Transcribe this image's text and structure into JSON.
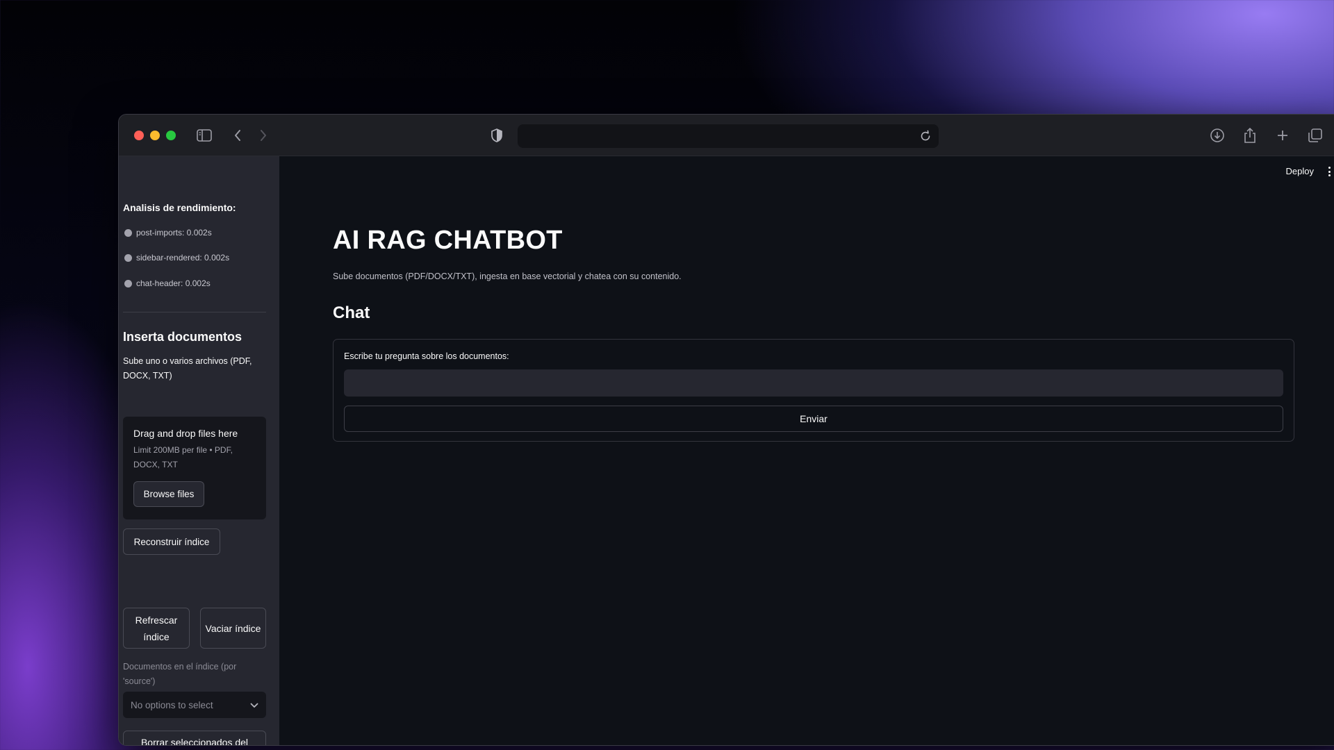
{
  "sidebar": {
    "perf_title": "Analisis de rendimiento:",
    "perf_items": [
      "post-imports: 0.002s",
      "sidebar-rendered: 0.002s",
      "chat-header: 0.002s"
    ],
    "upload_title": "Inserta documentos",
    "upload_subtitle": "Sube uno o varios archivos (PDF, DOCX, TXT)",
    "dropzone_title": "Drag and drop files here",
    "dropzone_limit": "Limit 200MB per file • PDF, DOCX, TXT",
    "browse_label": "Browse files",
    "rebuild_label": "Reconstruir índice",
    "refresh_label": "Refrescar índice",
    "empty_label": "Vaciar índice",
    "docs_label": "Documentos en el índice (por 'source')",
    "select_placeholder": "No options to select",
    "delete_label": "Borrar seleccionados del"
  },
  "header": {
    "deploy_label": "Deploy"
  },
  "main": {
    "title": "AI RAG CHATBOT",
    "subtitle": "Sube documentos (PDF/DOCX/TXT), ingesta en base vectorial y chatea con su contenido.",
    "chat_title": "Chat",
    "question_label": "Escribe tu pregunta sobre los documentos:",
    "question_value": "",
    "send_label": "Enviar"
  },
  "colors": {
    "app_bg": "#0e1117",
    "sidebar_bg": "#262730",
    "titlebar_bg": "#1e1f24"
  },
  "icons": [
    "sidebar-toggle-icon",
    "back-icon",
    "forward-icon",
    "shield-icon",
    "reload-icon",
    "download-icon",
    "share-icon",
    "new-tab-icon",
    "tabs-overview-icon",
    "chevron-down-icon",
    "kebab-menu-icon"
  ]
}
